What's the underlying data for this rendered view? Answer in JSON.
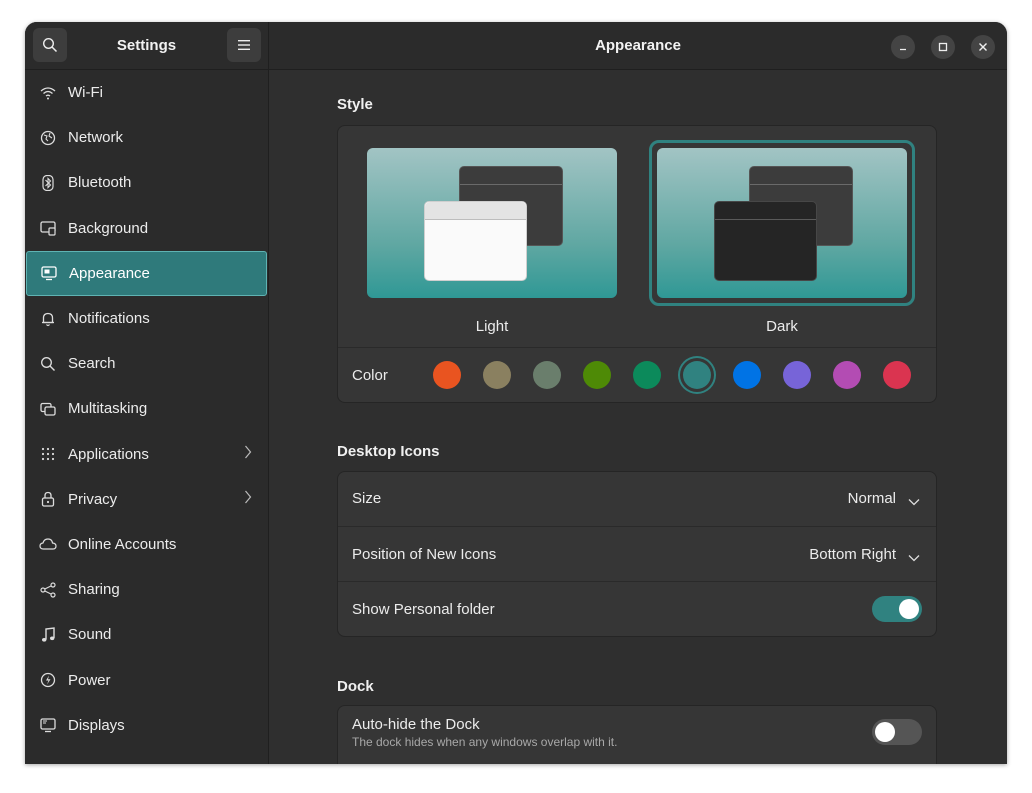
{
  "sidebar": {
    "title": "Settings",
    "items": [
      {
        "label": "Wi-Fi",
        "icon": "wifi-icon"
      },
      {
        "label": "Network",
        "icon": "network-icon"
      },
      {
        "label": "Bluetooth",
        "icon": "bluetooth-icon"
      },
      {
        "label": "Background",
        "icon": "background-icon"
      },
      {
        "label": "Appearance",
        "icon": "appearance-icon",
        "active": true
      },
      {
        "label": "Notifications",
        "icon": "bell-icon"
      },
      {
        "label": "Search",
        "icon": "search-icon"
      },
      {
        "label": "Multitasking",
        "icon": "multitasking-icon"
      },
      {
        "label": "Applications",
        "icon": "apps-grid-icon",
        "chevron": true
      },
      {
        "label": "Privacy",
        "icon": "lock-icon",
        "chevron": true
      },
      {
        "label": "Online Accounts",
        "icon": "cloud-icon"
      },
      {
        "label": "Sharing",
        "icon": "share-icon"
      },
      {
        "label": "Sound",
        "icon": "music-note-icon"
      },
      {
        "label": "Power",
        "icon": "power-icon"
      },
      {
        "label": "Displays",
        "icon": "display-icon"
      }
    ]
  },
  "header": {
    "title": "Appearance"
  },
  "style": {
    "title": "Style",
    "light_label": "Light",
    "dark_label": "Dark",
    "selected": "Dark",
    "color_label": "Color",
    "accent_colors": [
      "#e95420",
      "#8a8060",
      "#6a7e6c",
      "#4e8a06",
      "#0c8a5b",
      "#308280",
      "#0073e5",
      "#7764d8",
      "#b34cb3",
      "#da3450"
    ],
    "selected_color": "#308280"
  },
  "desktop_icons": {
    "title": "Desktop Icons",
    "size_label": "Size",
    "size_value": "Normal",
    "position_label": "Position of New Icons",
    "position_value": "Bottom Right",
    "personal_label": "Show Personal folder",
    "personal_on": true
  },
  "dock": {
    "title": "Dock",
    "autohide_label": "Auto-hide the Dock",
    "autohide_desc": "The dock hides when any windows overlap with it.",
    "autohide_on": false
  },
  "colors": {
    "accent": "#2f7a7b",
    "toggle_on": "#308280",
    "toggle_off": "#555555"
  }
}
